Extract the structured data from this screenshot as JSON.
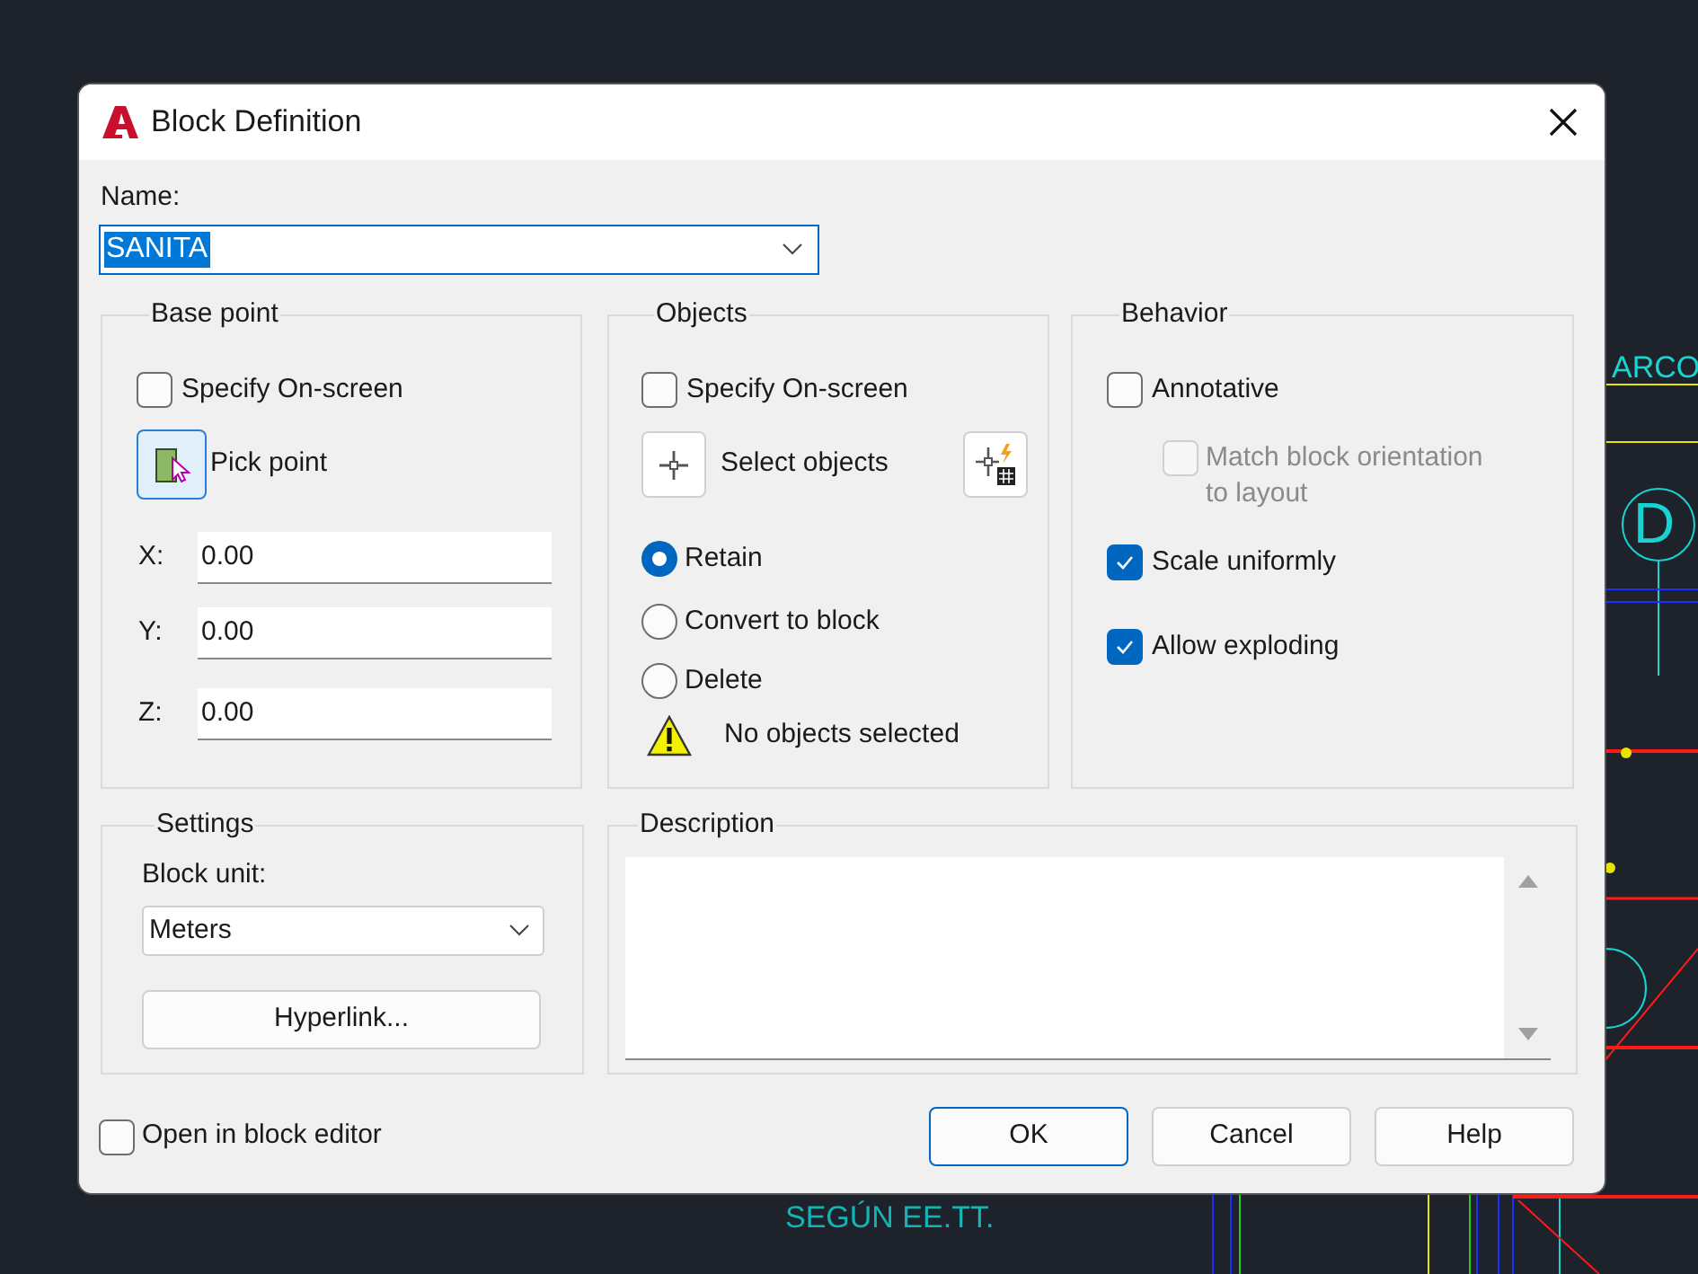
{
  "window": {
    "title": "Block Definition"
  },
  "name": {
    "label": "Name:",
    "value": "SANITA"
  },
  "base_point": {
    "title": "Base point",
    "specify_on_screen": {
      "label": "Specify On-screen",
      "checked": false
    },
    "pick_button": "Pick point",
    "coordinates": [
      {
        "label": "X:",
        "value": "0.00"
      },
      {
        "label": "Y:",
        "value": "0.00"
      },
      {
        "label": "Z:",
        "value": "0.00"
      }
    ]
  },
  "objects": {
    "title": "Objects",
    "specify_on_screen": {
      "label": "Specify On-screen",
      "checked": false
    },
    "select_button": "Select objects",
    "options": [
      {
        "label": "Retain",
        "selected": true
      },
      {
        "label": "Convert to block",
        "selected": false
      },
      {
        "label": "Delete",
        "selected": false
      }
    ],
    "status": "No objects selected"
  },
  "behavior": {
    "title": "Behavior",
    "options": [
      {
        "label": "Annotative",
        "checked": false,
        "disabled": false,
        "children": [
          {
            "label": "Match block orientation to layout",
            "checked": false,
            "disabled": true
          }
        ]
      },
      {
        "label": "Scale uniformly",
        "checked": true,
        "disabled": false
      },
      {
        "label": "Allow exploding",
        "checked": true,
        "disabled": false
      }
    ]
  },
  "settings": {
    "title": "Settings",
    "block_unit": {
      "label": "Block unit:",
      "value": "Meters"
    },
    "hyperlink_button": "Hyperlink..."
  },
  "description": {
    "title": "Description"
  },
  "open_in_block_editor": {
    "label": "Open in block editor",
    "checked": false
  },
  "buttons": [
    {
      "label": "OK",
      "default": true
    },
    {
      "label": "Cancel",
      "default": false
    },
    {
      "label": "Help",
      "default": false
    }
  ],
  "background_drawing": {
    "labels": [
      "ARCO",
      "D",
      "SEGÚN EE.TT."
    ]
  }
}
